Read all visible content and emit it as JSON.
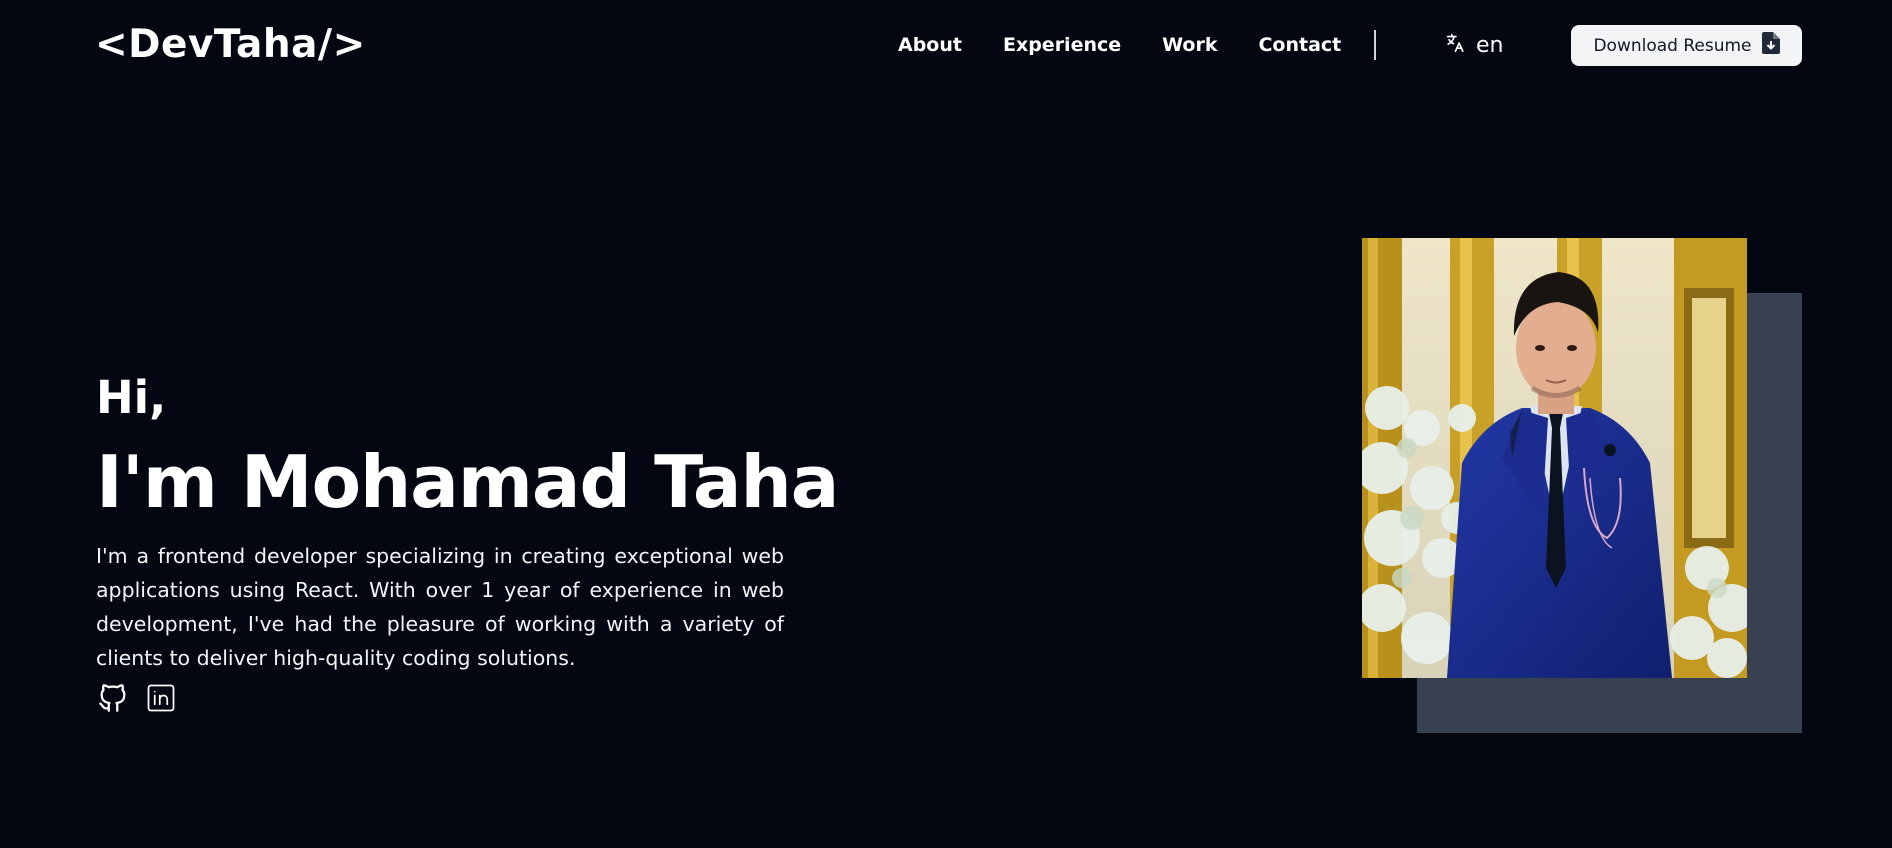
{
  "header": {
    "logo": "<DevTaha/>",
    "nav": [
      "About",
      "Experience",
      "Work",
      "Contact"
    ],
    "language": {
      "icon": "translate-icon",
      "code": "en"
    },
    "resume_button": {
      "label": "Download Resume",
      "icon": "file-download-icon"
    }
  },
  "hero": {
    "greeting": "Hi,",
    "headline": "I'm Mohamad Taha",
    "bio": "I'm a frontend developer specializing in creating exceptional web applications using React. With over 1 year of experience in web development, I've had the pleasure of working with a variety of clients to deliver high-quality coding solutions.",
    "socials": [
      {
        "icon": "github-icon"
      },
      {
        "icon": "linkedin-icon"
      }
    ]
  },
  "profile_photo": {
    "icon": "profile-photo"
  },
  "colors": {
    "background": "#030712",
    "text": "#ffffff",
    "photo_backdrop": "#374151",
    "button_bg": "#f3f4f6",
    "button_text": "#111827"
  }
}
